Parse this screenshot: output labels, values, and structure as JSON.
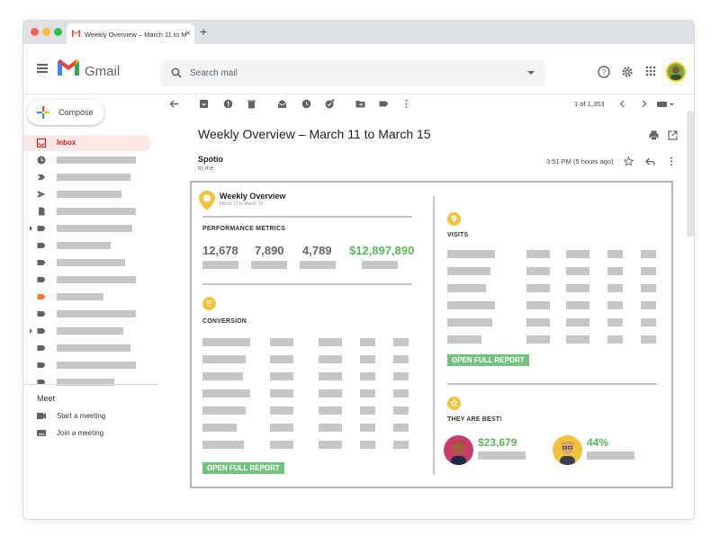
{
  "browser": {
    "tab_title": "Weekly Overview – March 11 to M",
    "close_glyph": "×",
    "new_tab_glyph": "+"
  },
  "gmail": {
    "logo_text": "Gmail",
    "search_placeholder": "Search mail",
    "compose_label": "Compose",
    "inbox_label": "Inbox",
    "meet_title": "Meet",
    "start_meeting": "Start a meeting",
    "join_meeting": "Join a meeting",
    "pagination": "1 of 1,353"
  },
  "email": {
    "subject": "Weekly Overview – March 11 to March 15",
    "sender": "Spotio",
    "recipient": "to me",
    "time": "3:51 PM (5 hours ago)"
  },
  "report": {
    "title": "Weekly Overview",
    "subtitle": "March 11 to March 15",
    "performance_title": "PERFORMANCE METRICS",
    "metrics": [
      "12,678",
      "7,890",
      "4,789",
      "$12,897,890"
    ],
    "conversion_title": "CONVERSION",
    "visits_title": "VISITS",
    "open_report_label": "OPEN FULL REPORT",
    "best_title": "THEY ARE BEST!",
    "best_values": [
      "$23,679",
      "44%"
    ]
  },
  "colors": {
    "accent_green": "#5cb85c",
    "badge_yellow": "#f2c23a",
    "inbox_red": "#c5221f"
  }
}
